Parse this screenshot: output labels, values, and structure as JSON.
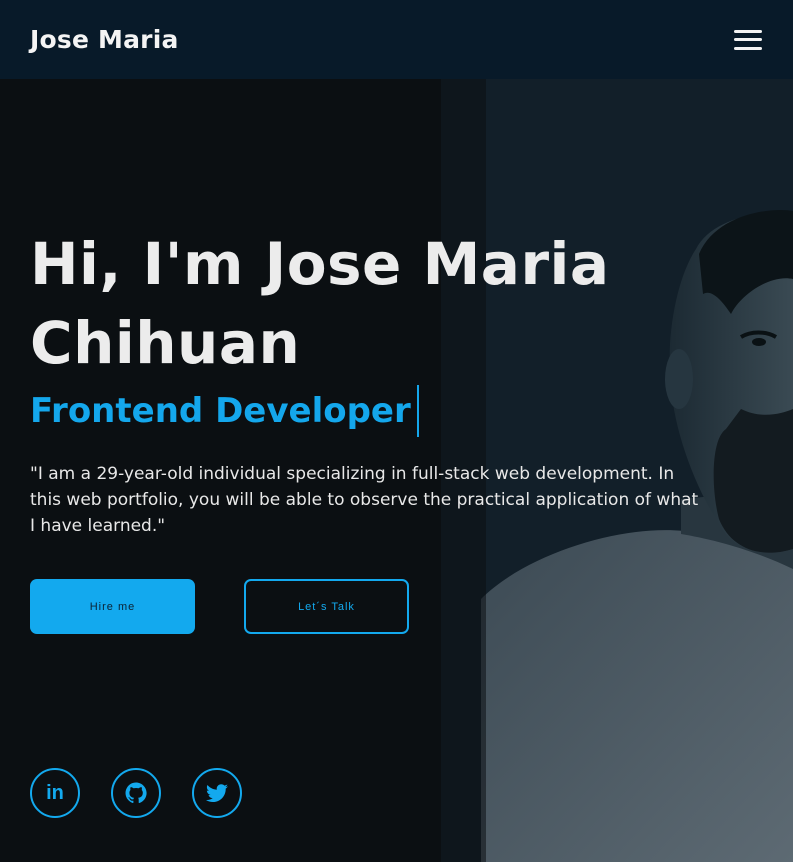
{
  "header": {
    "logo": "Jose Maria",
    "menu_icon": "hamburger-menu-icon"
  },
  "hero": {
    "title_line1": "Hi, I'm Jose Maria",
    "title_line2": "Chihuan",
    "role": "Frontend Developer",
    "bio": "\"I am a 29-year-old individual specializing in full-stack web development. In this web portfolio, you will be able to observe the practical application of what I have learned.\"",
    "buttons": {
      "hire": "Hire me",
      "talk": "Let´s Talk"
    },
    "social": [
      {
        "name": "linkedin",
        "icon": "linkedin-icon",
        "glyph": "in"
      },
      {
        "name": "github",
        "icon": "github-icon"
      },
      {
        "name": "twitter",
        "icon": "twitter-icon"
      }
    ]
  },
  "colors": {
    "accent": "#13a9ee",
    "header_bg": "#081a29",
    "page_bg": "#0b0f12",
    "text": "#ececec"
  }
}
